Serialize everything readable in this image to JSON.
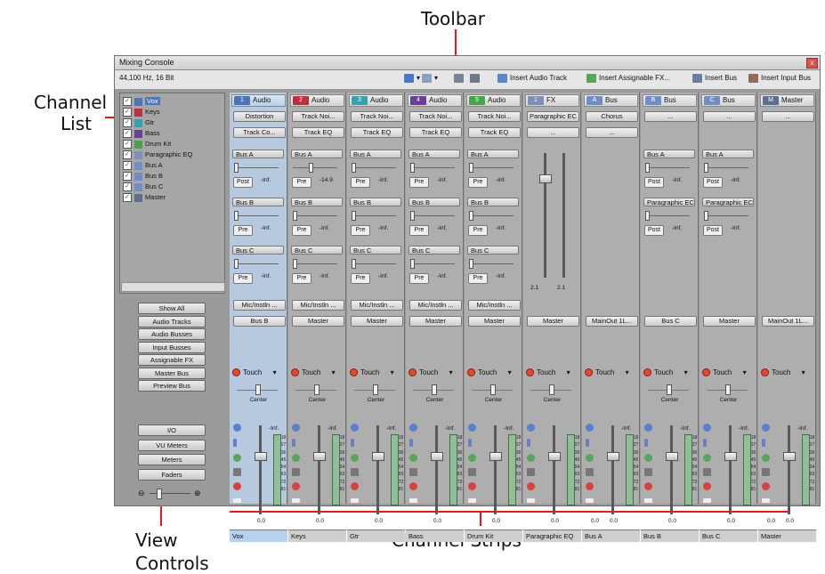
{
  "annotations": {
    "toolbar": "Toolbar",
    "channel_list_line1": "Channel",
    "channel_list_line2": "List",
    "view_controls_line1": "View",
    "view_controls_line2": "Controls",
    "channel_strips": "Channel Strips"
  },
  "window": {
    "title": "Mixing Console",
    "format": "44,100 Hz, 16 Bit",
    "close": "x"
  },
  "toolbar": {
    "insert_audio_track": "Insert Audio Track",
    "insert_assignable_fx": "Insert Assignable FX...",
    "insert_bus": "Insert Bus",
    "insert_input_bus": "Insert Input Bus"
  },
  "channel_list": [
    {
      "label": "Vox",
      "icon": "1"
    },
    {
      "label": "Keys",
      "icon": "2"
    },
    {
      "label": "Gtr",
      "icon": "3"
    },
    {
      "label": "Bass",
      "icon": "4"
    },
    {
      "label": "Drum Kit",
      "icon": "5"
    },
    {
      "label": "Paragraphic EQ",
      "icon": "1"
    },
    {
      "label": "Bus A",
      "icon": "A"
    },
    {
      "label": "Bus B",
      "icon": "B"
    },
    {
      "label": "Bus C",
      "icon": "C"
    },
    {
      "label": "Master",
      "icon": "M"
    }
  ],
  "view_buttons": [
    "Show All",
    "Audio Tracks",
    "Audio Busses",
    "Input Busses",
    "Assignable FX",
    "Master Bus",
    "Preview Bus"
  ],
  "view_buttons2": [
    "I/O",
    "VU Meters",
    "Meters",
    "Faders"
  ],
  "colors": {
    "audio1": "#4e74b5",
    "audio2": "#b8323b",
    "audio3": "#3c9fb0",
    "audio4": "#6a3f95",
    "audio5": "#4aa24e",
    "fx": "#7d8fb8",
    "bus": "#6f8fc4",
    "master": "#5d6f90"
  },
  "strips": [
    {
      "num": "1",
      "type": "Audio",
      "fx1": "Distortion",
      "fx2": "Track Co...",
      "sends": [
        {
          "bus": "Bus A",
          "mode": "Post",
          "level": "-Inf."
        },
        {
          "bus": "Bus B",
          "mode": "Pre",
          "level": "-Inf."
        },
        {
          "bus": "Bus C",
          "mode": "Pre",
          "level": "-Inf."
        }
      ],
      "io1": "Mic/Instln ...",
      "io2": "Bus B",
      "auto": "Touch",
      "pan": "Center",
      "fader_db": "-Inf.",
      "v1": "",
      "v2": "0.0",
      "name": "Vox"
    },
    {
      "num": "2",
      "type": "Audio",
      "fx1": "Track Noi...",
      "fx2": "Track EQ",
      "sends": [
        {
          "bus": "Bus A",
          "mode": "Pre",
          "level": "-14.9"
        },
        {
          "bus": "Bus B",
          "mode": "Pre",
          "level": "-Inf."
        },
        {
          "bus": "Bus C",
          "mode": "Pre",
          "level": "-Inf."
        }
      ],
      "io1": "Mic/Instln ...",
      "io2": "Master",
      "auto": "Touch",
      "pan": "Center",
      "fader_db": "-Inf.",
      "v1": "",
      "v2": "0.0",
      "name": "Keys"
    },
    {
      "num": "3",
      "type": "Audio",
      "fx1": "Track Noi...",
      "fx2": "Track EQ",
      "sends": [
        {
          "bus": "Bus A",
          "mode": "Pre",
          "level": "-Inf."
        },
        {
          "bus": "Bus B",
          "mode": "Pre",
          "level": "-Inf."
        },
        {
          "bus": "Bus C",
          "mode": "Pre",
          "level": "-Inf."
        }
      ],
      "io1": "Mic/Instln ...",
      "io2": "Master",
      "auto": "Touch",
      "pan": "Center",
      "fader_db": "-Inf.",
      "v1": "",
      "v2": "0.0",
      "name": "Gtr"
    },
    {
      "num": "4",
      "type": "Audio",
      "fx1": "Track Noi...",
      "fx2": "Track EQ",
      "sends": [
        {
          "bus": "Bus A",
          "mode": "Pre",
          "level": "-Inf."
        },
        {
          "bus": "Bus B",
          "mode": "Pre",
          "level": "-Inf."
        },
        {
          "bus": "Bus C",
          "mode": "Pre",
          "level": "-Inf."
        }
      ],
      "io1": "Mic/Instln ...",
      "io2": "Master",
      "auto": "Touch",
      "pan": "Center",
      "fader_db": "-Inf.",
      "v1": "",
      "v2": "0.0",
      "name": "Bass"
    },
    {
      "num": "5",
      "type": "Audio",
      "fx1": "Track Noi...",
      "fx2": "Track EQ",
      "sends": [
        {
          "bus": "Bus A",
          "mode": "Pre",
          "level": "-Inf."
        },
        {
          "bus": "Bus B",
          "mode": "Pre",
          "level": "-Inf."
        },
        {
          "bus": "Bus C",
          "mode": "Pre",
          "level": "-Inf."
        }
      ],
      "io1": "Mic/Instln ...",
      "io2": "Master",
      "auto": "Touch",
      "pan": "Center",
      "fader_db": "-Inf.",
      "v1": "",
      "v2": "0.0",
      "name": "Drum Kit"
    },
    {
      "num": "1",
      "type": "FX",
      "fx1": "Paragraphic EC",
      "fx2": "...",
      "sends": [],
      "io1": "",
      "io2": "Master",
      "auto": "Touch",
      "pan": "Center",
      "fader_db": "",
      "v1": "",
      "v2": "0.0",
      "fxvals": [
        "2.1",
        "2.1"
      ],
      "name": "Paragraphic EQ"
    },
    {
      "num": "A",
      "type": "Bus",
      "fx1": "Chorus",
      "fx2": "...",
      "sends": [],
      "io1": "",
      "io2": "MainOut 1L...",
      "auto": "Touch",
      "pan": "",
      "fader_db": "-Inf.",
      "v1": "0.0",
      "v2": "0.0",
      "name": "Bus A"
    },
    {
      "num": "B",
      "type": "Bus",
      "fx1": "...",
      "fx2": "",
      "sends": [
        {
          "bus": "Bus A",
          "mode": "Post",
          "level": "-Inf."
        },
        {
          "bus": "Paragraphic EC",
          "mode": "Post",
          "level": "-Inf."
        }
      ],
      "io1": "",
      "io2": "Bus C",
      "auto": "Touch",
      "pan": "Center",
      "fader_db": "-Inf.",
      "v1": "",
      "v2": "0.0",
      "name": "Bus B"
    },
    {
      "num": "C",
      "type": "Bus",
      "fx1": "...",
      "fx2": "",
      "sends": [
        {
          "bus": "Bus A",
          "mode": "Post",
          "level": "-Inf."
        },
        {
          "bus": "Paragraphic EC",
          "mode": "Post",
          "level": "-Inf."
        }
      ],
      "io1": "",
      "io2": "Master",
      "auto": "Touch",
      "pan": "Center",
      "fader_db": "-Inf.",
      "v1": "",
      "v2": "0.0",
      "name": "Bus C"
    },
    {
      "num": "M",
      "type": "Master",
      "fx1": "...",
      "fx2": "",
      "sends": [],
      "io1": "",
      "io2": "MainOut 1L...",
      "auto": "Touch",
      "pan": "",
      "fader_db": "-Inf.",
      "v1": "0.0",
      "v2": "0.0",
      "name": "Master"
    }
  ],
  "meter_scale": [
    "18",
    "27",
    "36",
    "45",
    "54",
    "63",
    "72",
    "81"
  ]
}
